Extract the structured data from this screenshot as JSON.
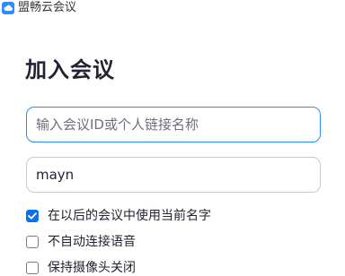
{
  "window": {
    "title": "盟畅云会议",
    "icon": "cloud-icon"
  },
  "main": {
    "heading": "加入会议",
    "meeting_field": {
      "placeholder": "输入会议ID或个人链接名称",
      "value": ""
    },
    "name_field": {
      "value": "mayn"
    },
    "options": [
      {
        "label": "在以后的会议中使用当前名字",
        "checked": true
      },
      {
        "label": "不自动连接语音",
        "checked": false
      },
      {
        "label": "保持摄像头关闭",
        "checked": false
      }
    ]
  },
  "colors": {
    "accent": "#0e72ed",
    "focus_border": "#2d8cff",
    "heading": "#232333"
  }
}
